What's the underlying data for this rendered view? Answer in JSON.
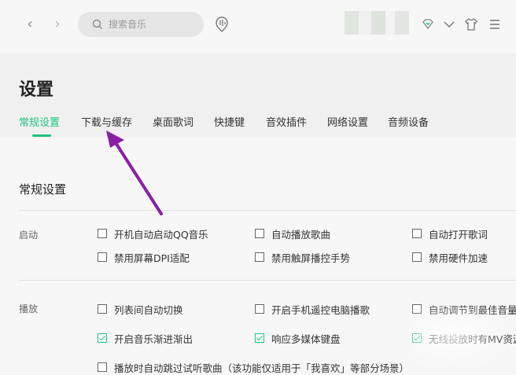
{
  "topbar": {
    "search_placeholder": "搜索音乐",
    "back_icon": "chevron-left-icon",
    "forward_icon": "chevron-right-icon",
    "right_icons": [
      "diamond-icon",
      "chevron-down-icon",
      "shirt-icon",
      "menu-icon"
    ]
  },
  "page": {
    "title": "设置",
    "tabs": [
      "常规设置",
      "下载与缓存",
      "桌面歌词",
      "快捷键",
      "音效插件",
      "网络设置",
      "音频设备"
    ],
    "active_tab": "常规设置"
  },
  "section": {
    "title": "常规设置",
    "groups": [
      {
        "label": "启动",
        "options": [
          {
            "label": "开机自动启动QQ音乐",
            "checked": false
          },
          {
            "label": "自动播放歌曲",
            "checked": false
          },
          {
            "label": "自动打开歌词",
            "checked": false
          },
          {
            "label": "禁用屏幕DPI适配",
            "checked": false
          },
          {
            "label": "禁用触屏播控手势",
            "checked": false
          },
          {
            "label": "禁用硬件加速",
            "checked": false
          }
        ]
      },
      {
        "label": "播放",
        "options": [
          {
            "label": "列表间自动切换",
            "checked": false
          },
          {
            "label": "开启手机遥控电脑播歌",
            "checked": false
          },
          {
            "label": "自动调节到最佳音量",
            "checked": false
          },
          {
            "label": "开启音乐渐进渐出",
            "checked": true
          },
          {
            "label": "响应多媒体键盘",
            "checked": true
          },
          {
            "label": "无线投放时有MV资源",
            "checked": true
          },
          {
            "label": "播放时自动跳过试听歌曲（该功能仅适用于「我喜欢」等部分场景）",
            "checked": false
          }
        ]
      }
    ]
  },
  "colors": {
    "accent": "#1ec37f",
    "annotation_arrow": "#8a1fa6"
  }
}
